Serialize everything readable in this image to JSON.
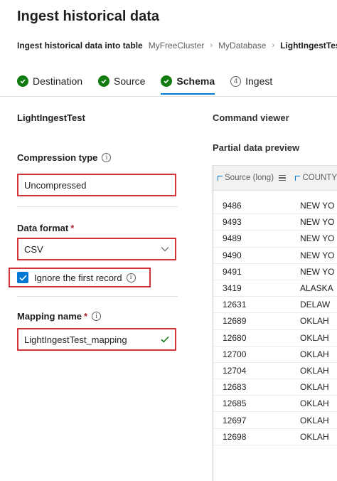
{
  "page": {
    "title": "Ingest historical data"
  },
  "breadcrumb": {
    "main": "Ingest historical data into table",
    "items": [
      "MyFreeCluster",
      "MyDatabase"
    ],
    "current": "LightIngestTest"
  },
  "steps": [
    {
      "label": "Destination",
      "state": "complete"
    },
    {
      "label": "Source",
      "state": "complete"
    },
    {
      "label": "Schema",
      "state": "active"
    },
    {
      "label": "Ingest",
      "number": "4",
      "state": "pending"
    }
  ],
  "form": {
    "section_title": "LightIngestTest",
    "compression": {
      "label": "Compression type",
      "value": "Uncompressed"
    },
    "data_format": {
      "label": "Data format",
      "required_mark": "*",
      "value": "CSV"
    },
    "ignore_first": {
      "label": "Ignore the first record",
      "checked": true
    },
    "mapping": {
      "label": "Mapping name",
      "required_mark": "*",
      "value": "LightIngestTest_mapping"
    }
  },
  "right": {
    "command_viewer": "Command viewer",
    "preview_title": "Partial data preview",
    "columns": [
      "Source (long)",
      "COUNTY"
    ],
    "rows": [
      [
        "9486",
        "NEW YO"
      ],
      [
        "9493",
        "NEW YO"
      ],
      [
        "9489",
        "NEW YO"
      ],
      [
        "9490",
        "NEW YO"
      ],
      [
        "9491",
        "NEW YO"
      ],
      [
        "3419",
        "ALASKA"
      ],
      [
        "12631",
        "DELAW"
      ],
      [
        "12689",
        "OKLAH"
      ],
      [
        "12680",
        "OKLAH"
      ],
      [
        "12700",
        "OKLAH"
      ],
      [
        "12704",
        "OKLAH"
      ],
      [
        "12683",
        "OKLAH"
      ],
      [
        "12685",
        "OKLAH"
      ],
      [
        "12697",
        "OKLAH"
      ],
      [
        "12698",
        "OKLAH"
      ]
    ]
  },
  "colors": {
    "accent": "#0078d4",
    "success": "#107c10",
    "highlight": "#d13438"
  }
}
